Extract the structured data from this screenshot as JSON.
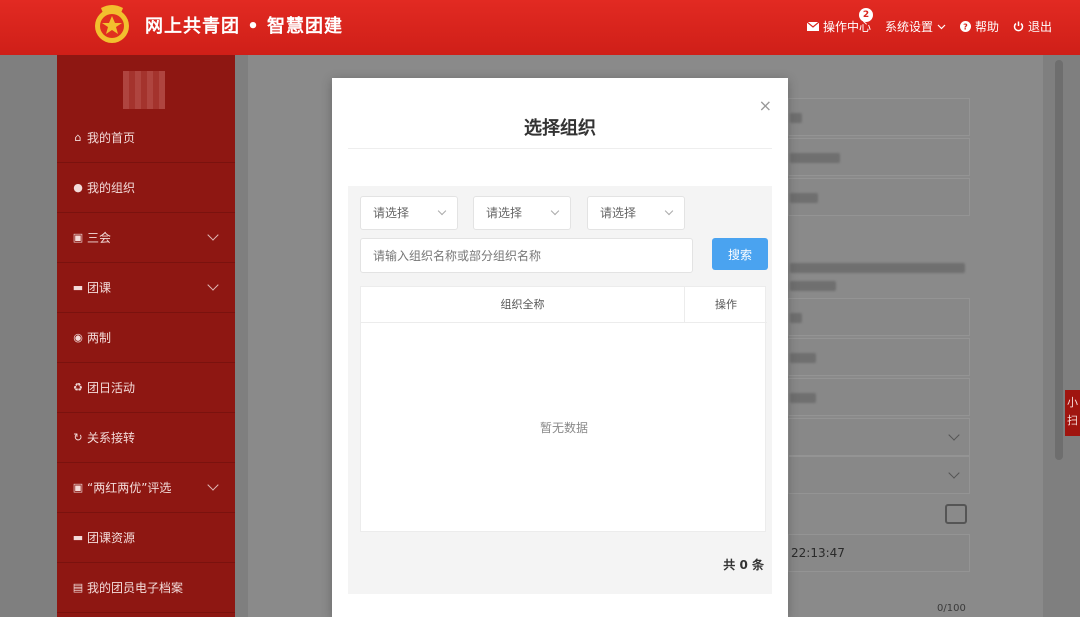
{
  "header": {
    "brand": "网上共青团 • 智慧团建",
    "nav": [
      {
        "label": "操作中心",
        "icon": "envelope-icon",
        "badge": "2"
      },
      {
        "label": "系统设置",
        "icon": "chevron-down-icon"
      },
      {
        "label": "帮助",
        "icon": "help-icon"
      },
      {
        "label": "退出",
        "icon": "power-icon"
      }
    ]
  },
  "sidebar": {
    "items": [
      {
        "label": "我的首页",
        "icon": "home-icon"
      },
      {
        "label": "我的组织",
        "icon": "users-icon"
      },
      {
        "label": "三会",
        "icon": "edit-icon"
      },
      {
        "label": "团课",
        "icon": "folder-icon"
      },
      {
        "label": "两制",
        "icon": "circle-dot-icon"
      },
      {
        "label": "团日活动",
        "icon": "recycle-icon"
      },
      {
        "label": "关系接转",
        "icon": "refresh-icon"
      },
      {
        "label": "“两红两优”评选",
        "icon": "edit-icon"
      },
      {
        "label": "团课资源",
        "icon": "folder-icon"
      },
      {
        "label": "我的团员电子档案",
        "icon": "file-icon"
      }
    ]
  },
  "background": {
    "timestamp": "22:13:47",
    "char_count": "0/100",
    "side_tab": "小扫"
  },
  "modal": {
    "title": "选择组织",
    "close_label": "×",
    "selects": [
      "请选择",
      "请选择",
      "请选择"
    ],
    "search_placeholder": "请输入组织名称或部分组织名称",
    "search_button": "搜索",
    "table": {
      "columns": [
        "组织全称",
        "操作"
      ],
      "empty_text": "暂无数据"
    },
    "total": "共 0 条"
  },
  "colors": {
    "header_red": "#d9241c",
    "sidebar_red": "#8e1712",
    "primary_blue": "#4aa3f0"
  }
}
